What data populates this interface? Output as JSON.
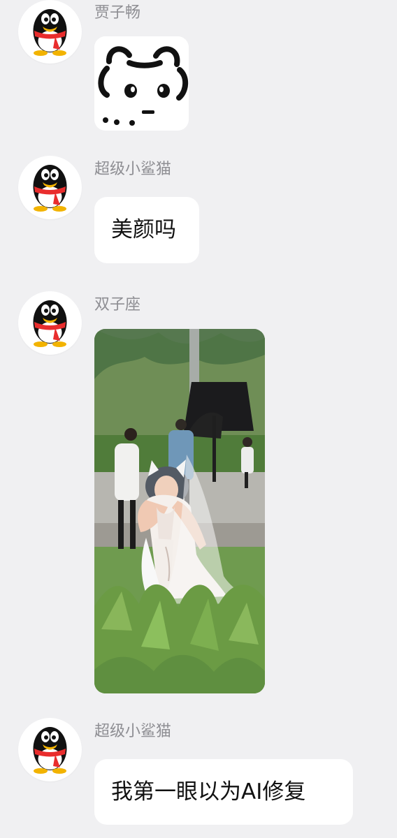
{
  "messages": [
    {
      "sender": "贾子畅",
      "content_type": "sticker",
      "sticker_icon": "bear-face-sticker-icon"
    },
    {
      "sender": "超级小鲨猫",
      "content_type": "text",
      "text": "美颜吗"
    },
    {
      "sender": "双子座",
      "content_type": "image",
      "image_icon": "outdoor-cosplay-photo-icon"
    },
    {
      "sender": "超级小鲨猫",
      "content_type": "text",
      "text": "我第一眼以为AI修复"
    }
  ],
  "colors": {
    "background": "#f0f0f2",
    "bubble": "#ffffff",
    "sender_text": "#8e8e93",
    "message_text": "#111111",
    "penguin_scarf": "#e92d2d",
    "penguin_feet": "#f2b300"
  }
}
